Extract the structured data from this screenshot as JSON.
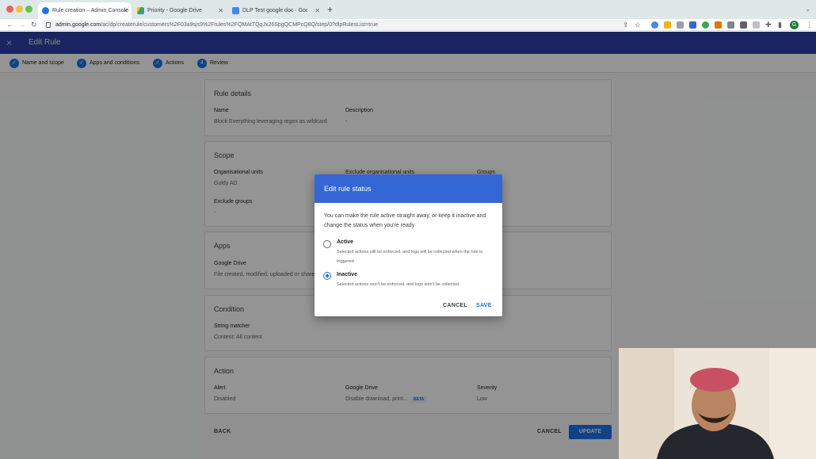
{
  "browser": {
    "tabs": [
      {
        "title": "Rule creation – Admin Console",
        "active": true
      },
      {
        "title": "Priority - Google Drive",
        "active": false
      },
      {
        "title": "DLP Test google doc - Google Docs",
        "active": false
      }
    ],
    "url_host": "admin.google.com",
    "url_path": "/ac/dp/createrule/customers%2F03a9sjs9%2Frules%2FQMAtTQqJx26SpgQCMPcQ8Q/step/0?dlpRulesList=true",
    "profile_initial": "G"
  },
  "header": {
    "close_icon": "×",
    "title": "Edit Rule"
  },
  "stepper": {
    "steps": [
      {
        "label": "Name and scope",
        "marker": "✓"
      },
      {
        "label": "Apps and conditions",
        "marker": "✓"
      },
      {
        "label": "Actions",
        "marker": "✓"
      },
      {
        "label": "Review",
        "marker": "4"
      }
    ]
  },
  "rule_details": {
    "title": "Rule details",
    "name_label": "Name",
    "name_value": "Block Everything leveraging regex as wildcard",
    "description_label": "Description",
    "description_value": "-"
  },
  "scope": {
    "title": "Scope",
    "org_units_label": "Organisational units",
    "org_units_value": "Goldy AD",
    "exclude_org_label": "Exclude organisational units",
    "groups_label": "Groups",
    "exclude_groups_label": "Exclude groups",
    "exclude_groups_value": "-"
  },
  "apps": {
    "title": "Apps",
    "app_label": "Google Drive",
    "app_value": "File created, modified, uploaded or shared"
  },
  "condition": {
    "title": "Condition",
    "label": "String matcher",
    "value": "Content: All content"
  },
  "action": {
    "title": "Action",
    "alert_label": "Alert",
    "alert_value": "Disabled",
    "drive_label": "Google Drive",
    "drive_value": "Disable download, print...",
    "beta": "BETA",
    "severity_label": "Severity",
    "severity_value": "Low"
  },
  "footer": {
    "back": "BACK",
    "cancel": "CANCEL",
    "update": "UPDATE"
  },
  "dialog": {
    "title": "Edit rule status",
    "description": "You can make the rule active straight away, or keep it inactive and change the status when you're ready",
    "options": [
      {
        "title": "Active",
        "desc": "Selected actions will be enforced, and logs will be collected when the rule is triggered",
        "selected": false
      },
      {
        "title": "Inactive",
        "desc": "Selected actions won't be enforced, and logs won't be collected",
        "selected": true
      }
    ],
    "cancel": "CANCEL",
    "save": "SAVE"
  },
  "colors": {
    "brand_header": "#2f43a6",
    "dialog_header": "#3367d6",
    "accent": "#1a73e8"
  }
}
